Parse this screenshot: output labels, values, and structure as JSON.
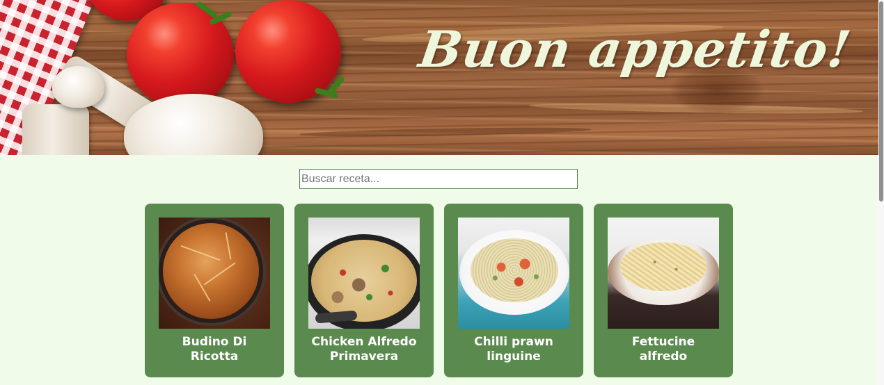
{
  "header": {
    "title": "Buon  appetito!"
  },
  "search": {
    "placeholder": "Buscar receta..."
  },
  "recipes": [
    {
      "title": "Budino Di Ricotta",
      "image_icon": "ricotta-cake-photo"
    },
    {
      "title": "Chicken Alfredo Primavera",
      "image_icon": "chicken-alfredo-photo"
    },
    {
      "title": "Chilli prawn linguine",
      "image_icon": "prawn-linguine-photo"
    },
    {
      "title": "Fettucine alfredo",
      "image_icon": "fettucine-photo"
    }
  ],
  "colors": {
    "background": "#f1fbea",
    "card": "#5b8a4e",
    "card_text": "#ffffff",
    "title_text": "#eef7dc",
    "search_border": "#5b7f4f"
  }
}
